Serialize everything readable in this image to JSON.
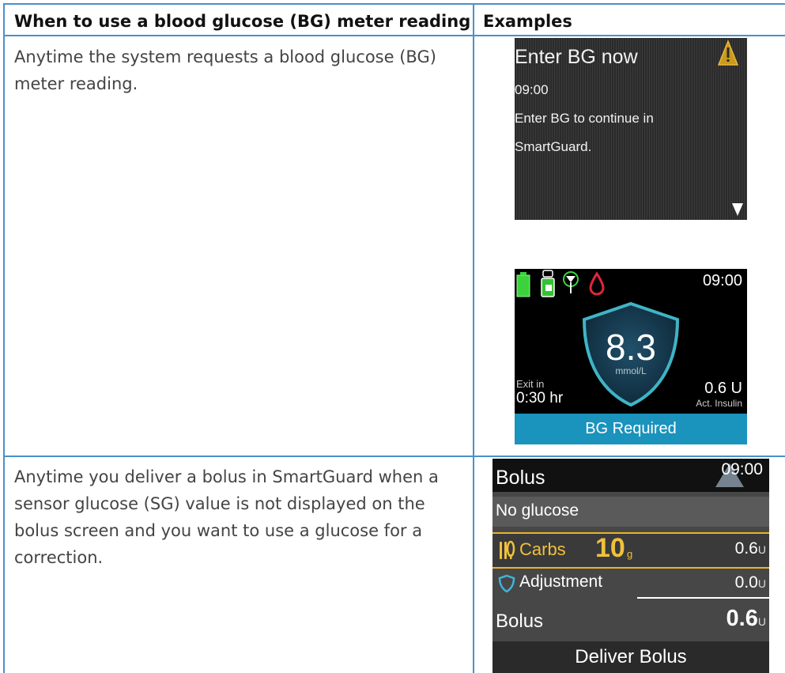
{
  "table": {
    "headers": [
      "When to use a blood glucose (BG) meter reading",
      "Examples"
    ],
    "rows": [
      {
        "text": "Anytime the system requests a blood glucose (BG) meter reading."
      },
      {
        "text": "Anytime you deliver a bolus in SmartGuard when a sensor glucose (SG) value is not displayed on the bolus screen and you want to use a glucose for a correction."
      }
    ]
  },
  "screen1": {
    "title": "Enter BG now",
    "time": "09:00",
    "message_line1": "Enter BG to continue in",
    "message_line2": "SmartGuard.",
    "icons": [
      "warning-icon",
      "down-arrow-icon"
    ]
  },
  "screen2": {
    "clock": "09:00",
    "glucose_value": "8.3",
    "glucose_unit": "mmol/L",
    "exit_label": "Exit in",
    "exit_value": "0:30 hr",
    "insulin_value": "0.6 U",
    "insulin_label": "Act. Insulin",
    "banner": "BG Required",
    "status_icons": [
      "battery-icon",
      "reservoir-icon",
      "sensor-connection-icon",
      "blood-drop-icon"
    ],
    "colors": {
      "banner": "#1a93bd",
      "shield": "#3fb4c6",
      "battery": "#3cd23c",
      "drop": "#e0263a"
    }
  },
  "screen3": {
    "title": "Bolus",
    "time": "09:00",
    "no_glucose": "No glucose",
    "carbs_label": "Carbs",
    "carbs_value": "10",
    "carbs_unit": "g",
    "carbs_insulin": "0.6",
    "adjustment_label": "Adjustment",
    "adjustment_value": "0.0",
    "bolus_label": "Bolus",
    "bolus_value": "0.6",
    "unit": "U",
    "deliver": "Deliver Bolus",
    "colors": {
      "highlight": "#e7b52b"
    }
  }
}
